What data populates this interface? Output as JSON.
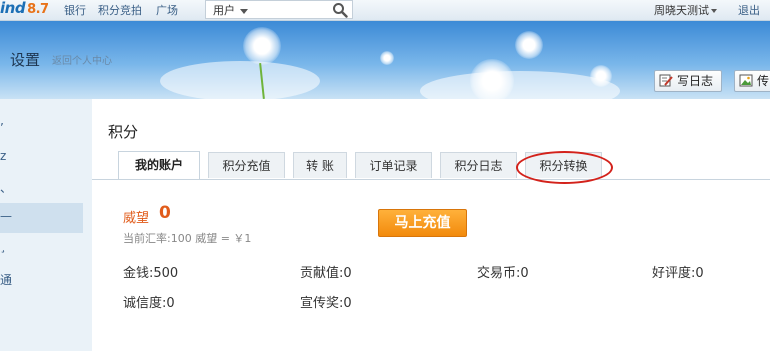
{
  "topbar": {
    "logo_text": "ind",
    "logo_version": "8.7",
    "nav": [
      "银行",
      "积分竞拍",
      "广场"
    ],
    "search_type": "用户",
    "username": "周晓天测试",
    "logout": "退出"
  },
  "banner": {
    "title": "设置",
    "subtitle": "返回个人中心",
    "write_log": "写日志",
    "upload_partial": "传"
  },
  "sidebar": {
    "items": [
      "’",
      "z",
      "、",
      "—",
      "¸",
      "通"
    ]
  },
  "main": {
    "title": "积分",
    "tabs": [
      "我的账户",
      "积分充值",
      "转 账",
      "订单记录",
      "积分日志",
      "积分转换"
    ],
    "active_tab": 0,
    "credit_name": "威望",
    "credit_value": "0",
    "exchange_rate": "当前汇率:100 威望 = ￥1",
    "recharge_button": "马上充值",
    "stats": [
      {
        "label": "金钱:",
        "value": "500"
      },
      {
        "label": "贡献值:",
        "value": "0"
      },
      {
        "label": "交易币:",
        "value": "0"
      },
      {
        "label": "好评度:",
        "value": "0"
      },
      {
        "label": "诚信度:",
        "value": "0"
      },
      {
        "label": "宣传奖:",
        "value": "0"
      }
    ]
  },
  "colors": {
    "link": "#3a5f86",
    "accent_orange": "#f28a0c",
    "credit_orange": "#e15c1b",
    "annotation_red": "#d3221b",
    "banner_blue": "#3c8ad6"
  }
}
